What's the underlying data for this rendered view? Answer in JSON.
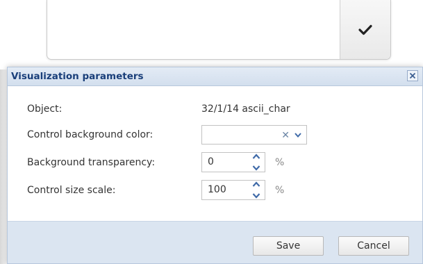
{
  "dialog": {
    "title": "Visualization parameters",
    "fields": {
      "object_label": "Object:",
      "object_value": "32/1/14 ascii_char",
      "bgcolor_label": "Control background color:",
      "bgcolor_value": "",
      "transparency_label": "Background transparency:",
      "transparency_value": "0",
      "transparency_unit": "%",
      "scale_label": "Control size scale:",
      "scale_value": "100",
      "scale_unit": "%"
    },
    "buttons": {
      "save": "Save",
      "cancel": "Cancel"
    }
  },
  "icons": {
    "confirm": "checkmark-icon",
    "close": "close-icon",
    "clear": "clear-x-icon",
    "dropdown": "chevron-down-icon",
    "spin": "spin-up-down-icon"
  },
  "colors": {
    "header_bg": "#d3dfee",
    "title_text": "#1a3f7a",
    "footer_bg": "#dbe5f1",
    "spinner_arrow": "#3f6aa8"
  }
}
